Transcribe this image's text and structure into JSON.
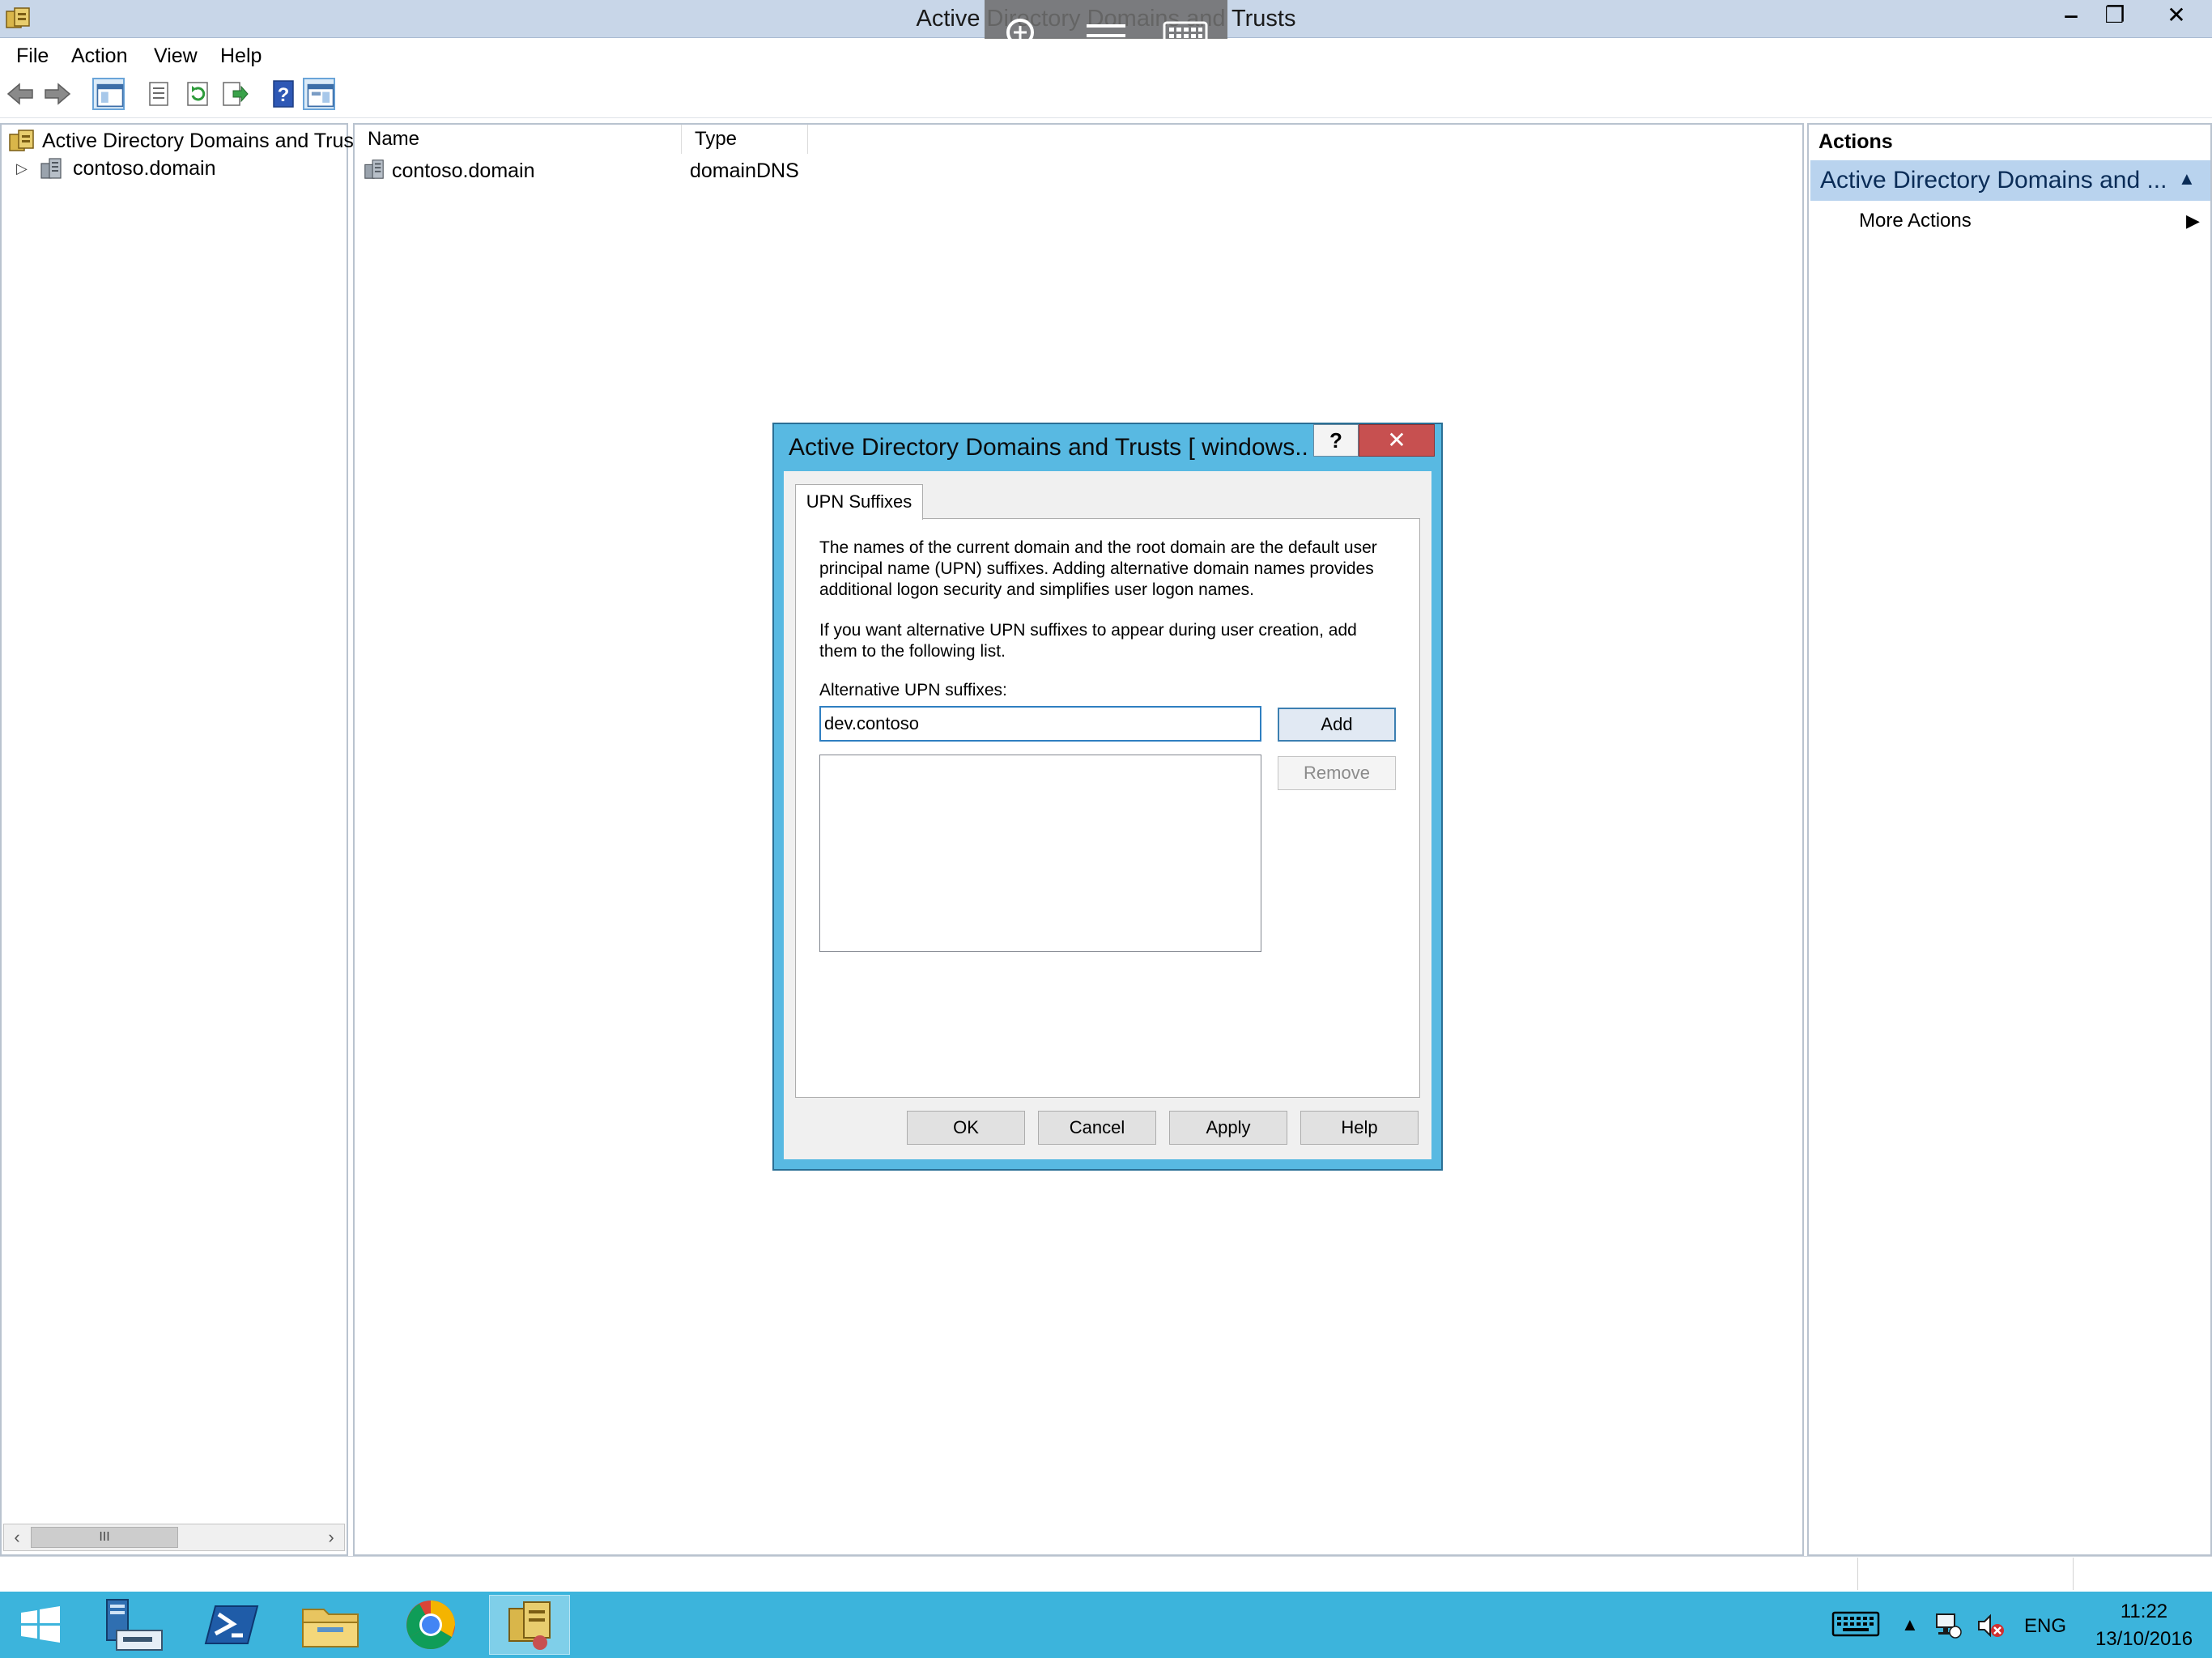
{
  "window": {
    "title": "Active Directory Domains and Trusts",
    "minimize_glyph": "‒",
    "restore_glyph": "❐",
    "close_glyph": "✕"
  },
  "menu": {
    "file": "File",
    "action": "Action",
    "view": "View",
    "help": "Help"
  },
  "tree": {
    "root_label": "Active Directory Domains and Trust",
    "child_label": "contoso.domain",
    "expander_glyph": "▷"
  },
  "scrollbar": {
    "left_glyph": "‹",
    "thumb_glyph": "III",
    "right_glyph": "›"
  },
  "list": {
    "columns": [
      "Name",
      "Type"
    ],
    "rows": [
      {
        "name": "contoso.domain",
        "type": "domainDNS"
      }
    ]
  },
  "actions": {
    "header": "Actions",
    "section_label": "Active Directory Domains and ...",
    "section_caret": "▲",
    "more_actions": "More Actions",
    "more_actions_arrow": "▶"
  },
  "dialog": {
    "title": "Active Directory Domains and Trusts [ windows...",
    "help_glyph": "?",
    "close_glyph": "✕",
    "tab_label": "UPN Suffixes",
    "description_1": "The names of the current domain and the root domain are the default user principal name (UPN) suffixes. Adding alternative domain names provides additional logon security and simplifies user logon names.",
    "description_2": "If you want alternative UPN suffixes to appear during user creation, add them to the following list.",
    "upn_label": "Alternative UPN suffixes:",
    "upn_value": "dev.contoso",
    "add_label": "Add",
    "remove_label": "Remove",
    "ok_label": "OK",
    "cancel_label": "Cancel",
    "apply_label": "Apply",
    "help_label": "Help"
  },
  "tray": {
    "overflow_glyph": "▲",
    "language": "ENG",
    "time": "11:22",
    "date": "13/10/2016"
  },
  "colors": {
    "taskbar": "#3cb4dc",
    "dialog_frame": "#58b9e2",
    "close_red": "#c75050",
    "actions_section": "#b9d3ee"
  }
}
